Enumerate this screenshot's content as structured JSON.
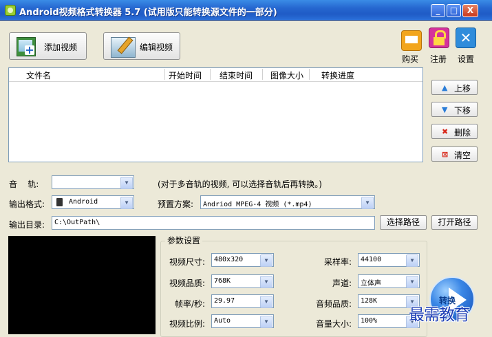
{
  "window": {
    "title": "Android视频格式转换器 5.7 (试用版只能转换源文件的一部分)",
    "minimize": "_",
    "maximize": "□",
    "close": "X"
  },
  "toolbar": {
    "add_video": "添加视频",
    "edit_video": "编辑视频",
    "buy": "购买",
    "register": "注册",
    "settings": "设置"
  },
  "list": {
    "columns": [
      "文件名",
      "开始时间",
      "结束时间",
      "图像大小",
      "转换进度"
    ]
  },
  "side_buttons": {
    "move_up": "上移",
    "move_down": "下移",
    "delete": "删除",
    "clear": "清空"
  },
  "audio_track": {
    "label": "音    轨:",
    "value": "",
    "hint": "(对于多音轨的视频, 可以选择音轨后再转换。)"
  },
  "output_format": {
    "label": "输出格式:",
    "value": "Android"
  },
  "preset": {
    "label": "预置方案:",
    "value": "Andriod MPEG-4 视频 (*.mp4)"
  },
  "output_dir": {
    "label": "输出目录:",
    "value": "C:\\OutPath\\",
    "choose_button": "选择路径",
    "open_button": "打开路径"
  },
  "params": {
    "title": "参数设置",
    "video_size_label": "视频尺寸:",
    "video_size": "480x320",
    "video_quality_label": "视频品质:",
    "video_quality": "768K",
    "fps_label": "帧率/秒:",
    "fps": "29.97",
    "aspect_label": "视频比例:",
    "aspect": "Auto",
    "sample_rate_label": "采样率:",
    "sample_rate": "44100",
    "channel_label": "声道:",
    "channel": "立体声",
    "audio_quality_label": "音频品质:",
    "audio_quality": "128K",
    "volume_label": "音量大小:",
    "volume": "100%"
  },
  "convert_button": "转换",
  "watermark": "最需教育"
}
